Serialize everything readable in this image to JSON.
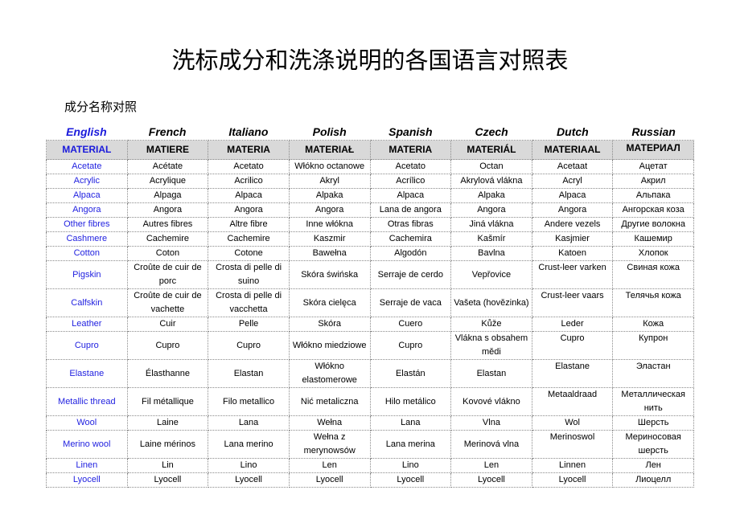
{
  "title": "洗标成分和洗涤说明的各国语言对照表",
  "subtitle": "成分名称对照",
  "languages": [
    "English",
    "French",
    "Italiano",
    "Polish",
    "Spanish",
    "Czech",
    "Dutch",
    "Russian"
  ],
  "header": [
    "MATERIAL",
    "MATIERE",
    "MATERIA",
    "MATERIAŁ",
    "MATERIA",
    "MATERIÁL",
    "MATERIAAL",
    "МАТЕРИАЛ"
  ],
  "rows": [
    [
      "Acetate",
      "Acétate",
      "Acetato",
      "Włókno octanowe",
      "Acetato",
      "Octan",
      "Acetaat",
      "Ацетат"
    ],
    [
      "Acrylic",
      "Acrylique",
      "Acrilico",
      "Akryl",
      "Acrílico",
      "Akrylová vlákna",
      "Acryl",
      "Акрил"
    ],
    [
      "Alpaca",
      "Alpaga",
      "Alpaca",
      "Alpaka",
      "Alpaca",
      "Alpaka",
      "Alpaca",
      "Альпака"
    ],
    [
      "Angora",
      "Angora",
      "Angora",
      "Angora",
      "Lana de angora",
      "Angora",
      "Angora",
      "Ангорская коза"
    ],
    [
      "Other fibres",
      "Autres fibres",
      "Altre fibre",
      "Inne włókna",
      "Otras fibras",
      "Jiná vlákna",
      "Andere vezels",
      "Другие волокна"
    ],
    [
      "Cashmere",
      "Cachemire",
      "Cachemire",
      "Kaszmir",
      "Cachemira",
      "Kašmír",
      "Kasjmier",
      "Кашемир"
    ],
    [
      "Cotton",
      "Coton",
      "Cotone",
      "Bawełna",
      "Algodón",
      "Bavlna",
      "Katoen",
      "Хлопок"
    ],
    [
      "Pigskin",
      "Croûte de cuir de porc",
      "Crosta di pelle di suino",
      "Skóra świńska",
      "Serraje de cerdo",
      "Vepřovice",
      "Crust-leer varken",
      "Свиная кожа"
    ],
    [
      "Calfskin",
      "Croûte de cuir de vachette",
      "Crosta di pelle di vacchetta",
      "Skóra cielęca",
      "Serraje de vaca",
      "Vašeta (hovězinka)",
      "Crust-leer vaars",
      "Телячья кожа"
    ],
    [
      "Leather",
      "Cuir",
      "Pelle",
      "Skóra",
      "Cuero",
      "Kůže",
      "Leder",
      "Кожа"
    ],
    [
      "Cupro",
      "Cupro",
      "Cupro",
      "Włókno miedziowe",
      "Cupro",
      "Vlákna s obsahem mědi",
      "Cupro",
      "Купрон"
    ],
    [
      "Elastane",
      "Élasthanne",
      "Elastan",
      "Włókno elastomerowe",
      "Elastán",
      "Elastan",
      "Elastane",
      "Эластан"
    ],
    [
      "Metallic thread",
      "Fil métallique",
      "Filo metallico",
      "Nić metaliczna",
      "Hilo metálico",
      "Kovové vlákno",
      "Metaaldraad",
      "Металлическая нить"
    ],
    [
      "Wool",
      "Laine",
      "Lana",
      "Wełna",
      "Lana",
      "Vlna",
      "Wol",
      "Шерсть"
    ],
    [
      "Merino wool",
      "Laine mérinos",
      "Lana merino",
      "Wełna z merynowsów",
      "Lana merina",
      "Merinová vlna",
      "Merinoswol",
      "Мериносовая шерсть"
    ],
    [
      "Linen",
      "Lin",
      "Lino",
      "Len",
      "Lino",
      "Len",
      "Linnen",
      "Лен"
    ],
    [
      "Lyocell",
      "Lyocell",
      "Lyocell",
      "Lyocell",
      "Lyocell",
      "Lyocell",
      "Lyocell",
      "Лиоцелл"
    ]
  ],
  "colors": {
    "english_text": "#2222e0",
    "header_bg": "#d9d9d9",
    "border": "#8a8a8a"
  }
}
